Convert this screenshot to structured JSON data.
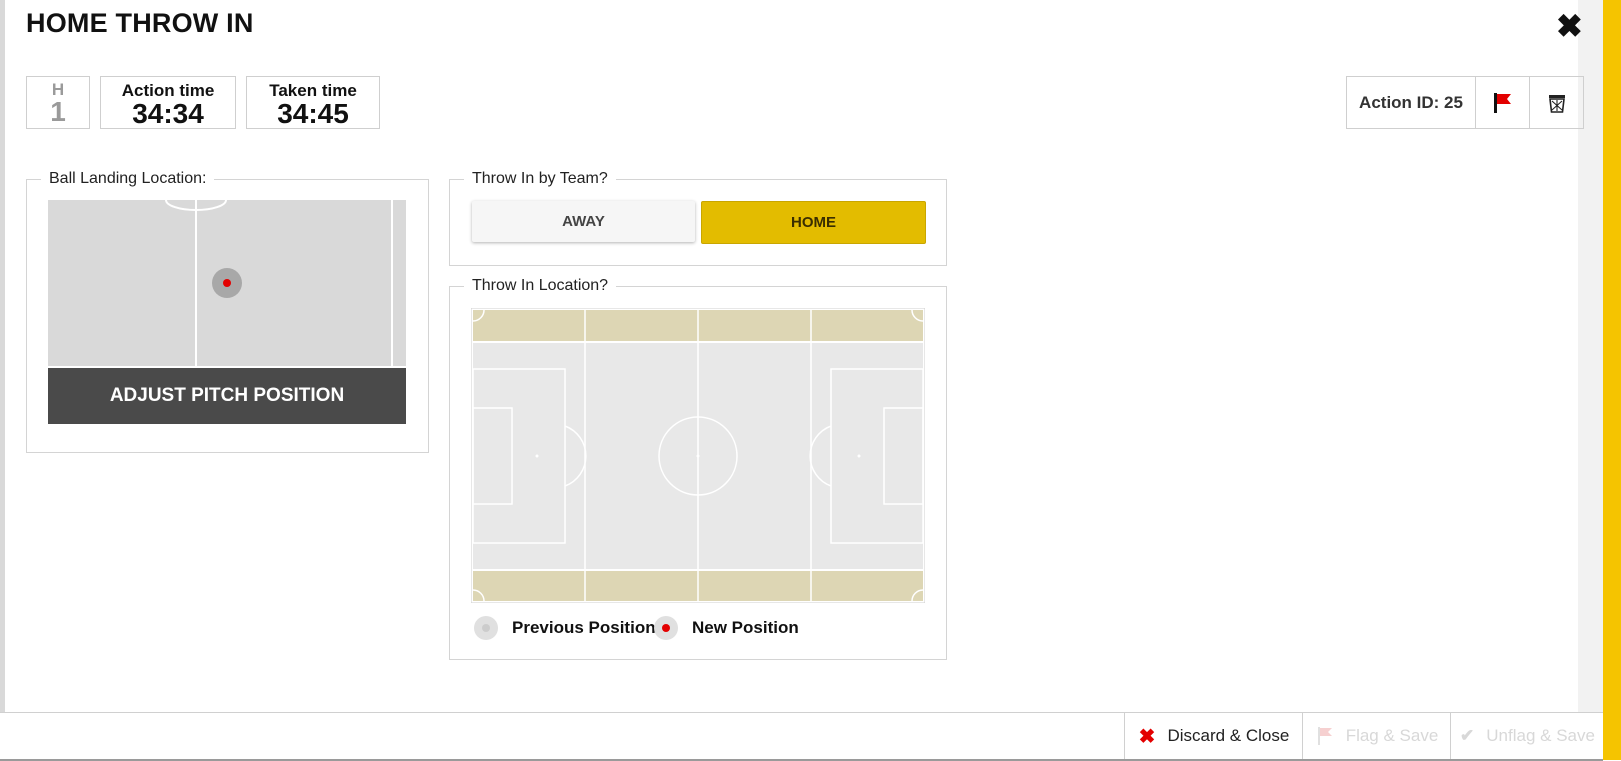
{
  "header": {
    "title": "HOME THROW IN",
    "close_icon": "close-icon"
  },
  "period": {
    "label": "H",
    "number": "1"
  },
  "action_time": {
    "label": "Action time",
    "value": "34:34"
  },
  "taken_time": {
    "label": "Taken time",
    "value": "34:45"
  },
  "action_bar": {
    "action_id": "Action ID: 25",
    "flag_icon": "flag-icon",
    "trash_icon": "trash-icon"
  },
  "ball_landing": {
    "legend": "Ball Landing Location:",
    "adjust_button": "ADJUST PITCH POSITION"
  },
  "throw_in_team": {
    "legend": "Throw In by Team?",
    "options": [
      "AWAY",
      "HOME"
    ],
    "selected": "HOME"
  },
  "throw_in_location": {
    "legend": "Throw In Location?",
    "legend_items": [
      {
        "label": "Previous Position",
        "color": "#cccccc"
      },
      {
        "label": "New Position",
        "color": "#e30000"
      }
    ]
  },
  "footer": {
    "discard_label": "Discard & Close",
    "flag_save_label": "Flag & Save",
    "unflag_save_label": "Unflag & Save"
  },
  "colors": {
    "accent": "#f5c400",
    "home_selected": "#e3bc00",
    "pitch_grey": "#e8e8e8",
    "throw_zone": "#ddd6b4",
    "marker_red": "#e30000"
  }
}
